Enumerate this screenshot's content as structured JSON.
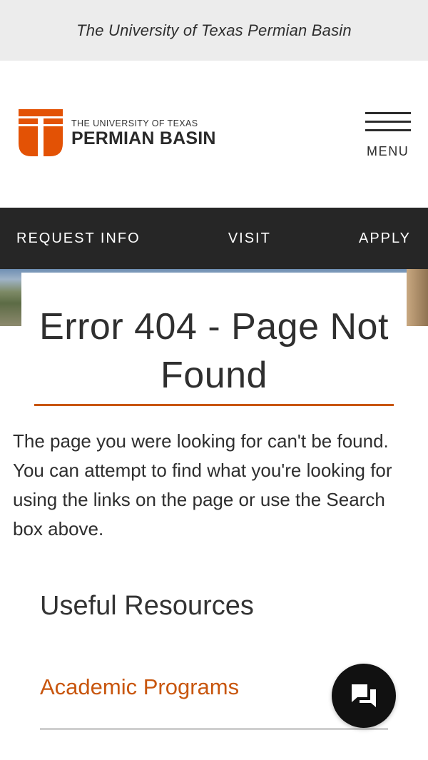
{
  "topbar": {
    "title": "The University of Texas Permian Basin"
  },
  "logo": {
    "line1": "THE UNIVERSITY OF TEXAS",
    "line2": "PERMIAN BASIN",
    "brand_color": "#e35205"
  },
  "header": {
    "menu_label": "MENU"
  },
  "nav": {
    "items": [
      {
        "label": "REQUEST INFO"
      },
      {
        "label": "VISIT"
      },
      {
        "label": "APPLY"
      }
    ]
  },
  "error": {
    "title": "Error 404 - Page Not Found",
    "message": "The page you were looking for can't be found. You can attempt to find what you're looking for using the links on the page or use the Search box above."
  },
  "resources": {
    "heading": "Useful Resources",
    "links": [
      {
        "label": "Academic Programs"
      }
    ]
  },
  "chat": {
    "icon": "chat-icon"
  },
  "colors": {
    "accent": "#c8560e",
    "nav_bg": "#262626",
    "topbar_bg": "#ececec"
  }
}
